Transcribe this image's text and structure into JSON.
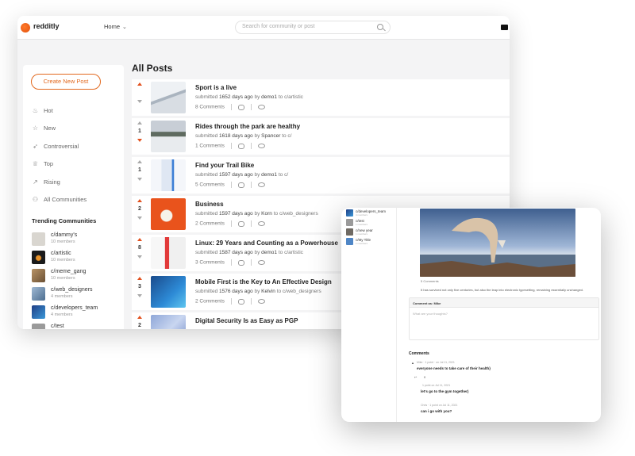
{
  "app": {
    "name": "redditly"
  },
  "topbar": {
    "home_label": "Home",
    "search_placeholder": "Search for community or post"
  },
  "sidebar": {
    "create_label": "Create New Post",
    "nav": [
      {
        "label": "Hot",
        "icon": "flame-icon"
      },
      {
        "label": "New",
        "icon": "star-icon"
      },
      {
        "label": "Controversial",
        "icon": "rocket-icon"
      },
      {
        "label": "Top",
        "icon": "trophy-icon"
      },
      {
        "label": "Rising",
        "icon": "trend-up-icon"
      },
      {
        "label": "All Communities",
        "icon": "people-icon"
      }
    ],
    "trending_title": "Trending Communities",
    "communities": [
      {
        "name": "c/dammy's",
        "members": "10 members",
        "color": "#d9d6d0"
      },
      {
        "name": "c/artistic",
        "members": "10 members",
        "color": "#1b1b1b"
      },
      {
        "name": "c/meme_gang",
        "members": "10 members",
        "color": "#8a6e4c"
      },
      {
        "name": "c/web_designers",
        "members": "4 members",
        "color": "#6b8fb3"
      },
      {
        "name": "c/developers_team",
        "members": "4 members",
        "color": "#2c6fb6"
      },
      {
        "name": "c/test",
        "members": "",
        "color": "#999999"
      }
    ]
  },
  "main": {
    "heading": "All Posts",
    "posts": [
      {
        "title": "Sport is a live",
        "votes": "",
        "submitted": "submitted",
        "age": "1652 days ago",
        "by": "by",
        "user": "demo1",
        "to": "to",
        "community": "c/artistic",
        "comments": "8 Comments",
        "up": true,
        "down": false
      },
      {
        "title": "Rides through the park are healthy",
        "votes": "1",
        "submitted": "submitted",
        "age": "1618 days ago",
        "by": "by",
        "user": "Spancer",
        "to": "to",
        "community": "c/",
        "comments": "1 Comments",
        "up": false,
        "down": true
      },
      {
        "title": "Find your Trail Bike",
        "votes": "1",
        "submitted": "submitted",
        "age": "1597 days ago",
        "by": "by",
        "user": "demo1",
        "to": "to",
        "community": "c/",
        "comments": "5 Comments",
        "up": false,
        "down": false
      },
      {
        "title": "Business",
        "votes": "2",
        "submitted": "submitted",
        "age": "1597 days ago",
        "by": "by",
        "user": "Korn",
        "to": "to",
        "community": "c/web_designers",
        "comments": "2 Comments",
        "up": true,
        "down": false
      },
      {
        "title": "Linux: 29 Years and Counting as a Powerhouse",
        "votes": "8",
        "submitted": "submitted",
        "age": "1587 days ago",
        "by": "by",
        "user": "demo1",
        "to": "to",
        "community": "c/artistic",
        "comments": "3 Comments",
        "up": true,
        "down": false
      },
      {
        "title": "Mobile First is the Key to An Effective Design",
        "votes": "3",
        "submitted": "submitted",
        "age": "1576 days ago",
        "by": "by",
        "user": "Kelvin",
        "to": "to",
        "community": "c/web_designers",
        "comments": "2 Comments",
        "up": true,
        "down": false
      },
      {
        "title": "Digital Security Is as Easy as PGP",
        "votes": "2",
        "submitted": "",
        "age": "",
        "by": "",
        "user": "",
        "to": "",
        "community": "",
        "comments": "",
        "up": true,
        "down": false
      }
    ]
  },
  "detail": {
    "communities": [
      {
        "name": "c/developers_team",
        "members": "4 members"
      },
      {
        "name": "c/test",
        "members": "1 members"
      },
      {
        "name": "c/new year",
        "members": "1 members"
      },
      {
        "name": "c/My Title",
        "members": "1 members"
      }
    ],
    "post_actions": "5 Comments",
    "post_text": "It has survived not only five centuries, but also the leap into electronic typesetting, remaining essentially unchanged.",
    "comment_as": "Comment as: Mike",
    "comment_placeholder": "What are your thoughts?",
    "comments_title": "Comments",
    "comments": [
      {
        "meta": "Mike · 1 point · on Jul 11, 2021",
        "text": "everyone needs to take care of their health}"
      },
      {
        "meta": "1 point on Jul 11, 2021",
        "text": "let's go to the gym together)"
      },
      {
        "meta": "Chris · 1 point on Jul 11, 2021",
        "text": "can i go with you?"
      }
    ],
    "reply_vote": "0"
  }
}
